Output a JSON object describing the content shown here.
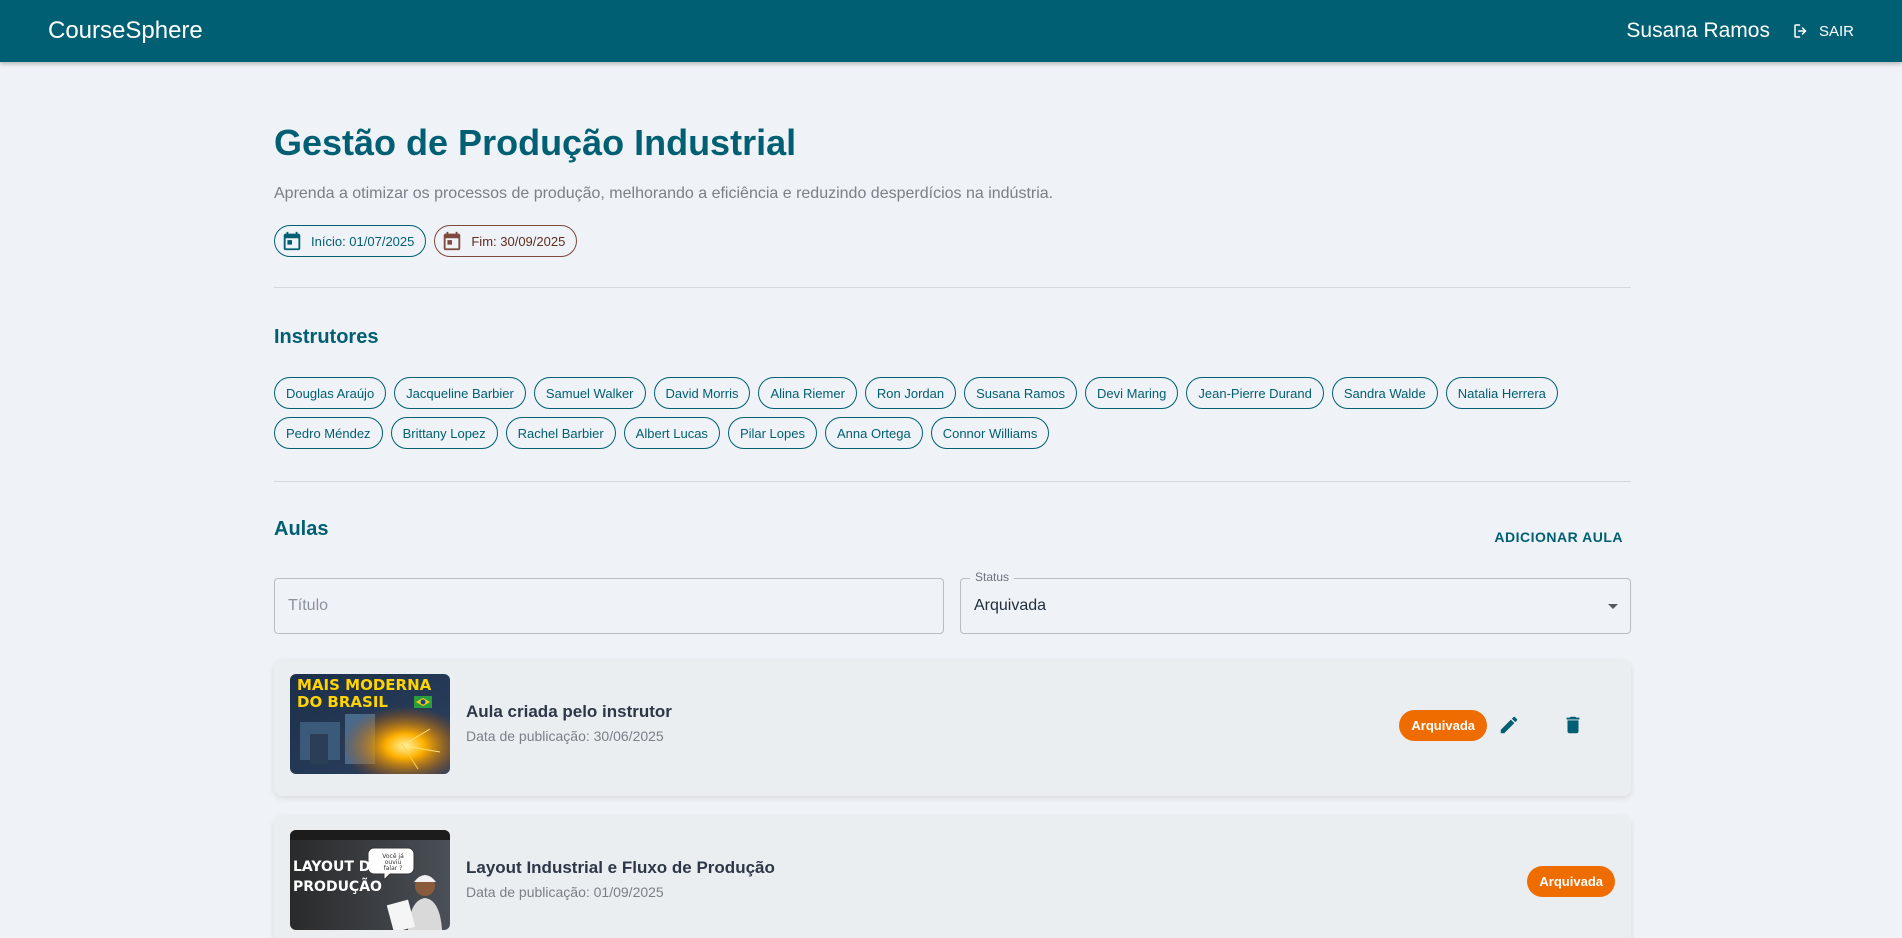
{
  "header": {
    "brand": "CourseSphere",
    "user_name": "Susana Ramos",
    "logout_label": "SAIR"
  },
  "course": {
    "title": "Gestão de Produção Industrial",
    "description": "Aprenda a otimizar os processos de produção, melhorando a eficiência e reduzindo desperdícios na indústria.",
    "start_label": "Início: 01/07/2025",
    "end_label": "Fim: 30/09/2025"
  },
  "instructors": {
    "title": "Instrutores",
    "names": [
      "Douglas Araújo",
      "Jacqueline Barbier",
      "Samuel Walker",
      "David Morris",
      "Alina Riemer",
      "Ron Jordan",
      "Susana Ramos",
      "Devi Maring",
      "Jean-Pierre Durand",
      "Sandra Walde",
      "Natalia Herrera",
      "Pedro Méndez",
      "Brittany Lopez",
      "Rachel Barbier",
      "Albert Lucas",
      "Pilar Lopes",
      "Anna Ortega",
      "Connor Williams"
    ]
  },
  "lessons": {
    "title": "Aulas",
    "add_label": "ADICIONAR AULA",
    "filter_title_placeholder": "Título",
    "filter_status_label": "Status",
    "filter_status_value": "Arquivada",
    "items": [
      {
        "title": "Aula criada pelo instrutor",
        "date": "Data de publicação: 30/06/2025",
        "status": "Arquivada",
        "thumb_text_1": "MAIS MODERNA",
        "thumb_text_2": "DO BRASIL",
        "editable": true
      },
      {
        "title": "Layout Industrial e Fluxo de Produção",
        "date": "Data de publicação: 01/09/2025",
        "status": "Arquivada",
        "thumb_text_1": "LAYOUT DE",
        "thumb_text_2": "PRODUÇÃO",
        "thumb_bubble": "Você já ouviu falar ?",
        "editable": false
      }
    ]
  },
  "colors": {
    "primary": "#005f73",
    "status_archived": "#ef6c00",
    "background": "#eff2f6"
  }
}
